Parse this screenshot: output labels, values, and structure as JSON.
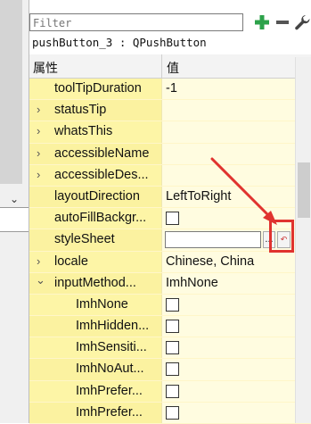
{
  "filter": {
    "placeholder": "Filter"
  },
  "object_label": "pushButton_3 : QPushButton",
  "header": {
    "property": "属性",
    "value": "值"
  },
  "icons": {
    "add": "plus-icon",
    "remove": "minus-icon",
    "configure": "wrench-icon"
  },
  "colors": {
    "property_cell": "#fdf5a6",
    "value_cell": "#fffce0",
    "highlight": "#e0332f",
    "add_icon": "#2ca24a"
  },
  "rows": [
    {
      "name": "toolTipDuration",
      "value": "-1",
      "arrow": ""
    },
    {
      "name": "statusTip",
      "value": "",
      "arrow": "›"
    },
    {
      "name": "whatsThis",
      "value": "",
      "arrow": "›"
    },
    {
      "name": "accessibleName",
      "value": "",
      "arrow": "›"
    },
    {
      "name": "accessibleDes...",
      "value": "",
      "arrow": "›"
    },
    {
      "name": "layoutDirection",
      "value": "LeftToRight",
      "arrow": ""
    },
    {
      "name": "autoFillBackgr...",
      "value": "",
      "arrow": ""
    },
    {
      "name": "styleSheet",
      "value": "",
      "arrow": "",
      "dots_label": "..."
    },
    {
      "name": "locale",
      "value": "Chinese, China",
      "arrow": "›"
    },
    {
      "name": "inputMethod...",
      "value": "ImhNone",
      "arrow": "⌄"
    },
    {
      "name": "ImhNone",
      "value": "",
      "arrow": ""
    },
    {
      "name": "ImhHidden...",
      "value": "",
      "arrow": ""
    },
    {
      "name": "ImhSensiti...",
      "value": "",
      "arrow": ""
    },
    {
      "name": "ImhNoAut...",
      "value": "",
      "arrow": ""
    },
    {
      "name": "ImhPrefer...",
      "value": "",
      "arrow": ""
    },
    {
      "name": "ImhPrefer...",
      "value": "",
      "arrow": ""
    }
  ]
}
